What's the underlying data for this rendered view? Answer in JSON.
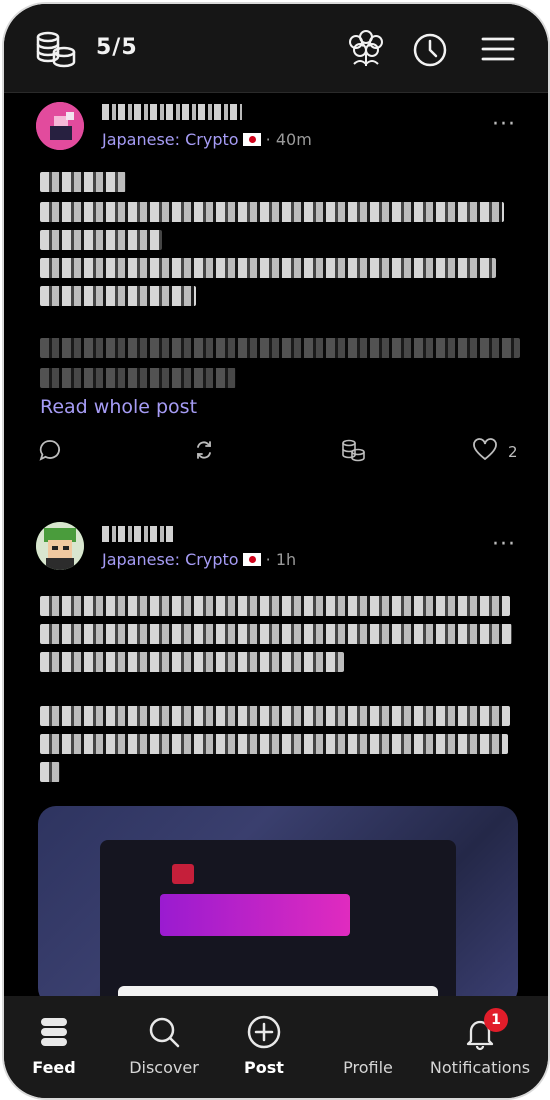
{
  "topbar": {
    "counter": "5/5",
    "icons": [
      "coins-icon",
      "flower-mascot-icon",
      "clock-icon",
      "menu-icon"
    ]
  },
  "posts": [
    {
      "author": "",
      "channel": "Japanese: Crypto",
      "flag": "japan-flag-icon",
      "time": "40m",
      "more": "···",
      "read_more": "Read whole post",
      "likes": "2"
    },
    {
      "author": "",
      "channel": "Japanese: Crypto",
      "flag": "japan-flag-icon",
      "time": "1h",
      "more": "···"
    }
  ],
  "separator": "·",
  "tabs": [
    {
      "label": "Feed",
      "icon": "feed-icon"
    },
    {
      "label": "Discover",
      "icon": "search-icon"
    },
    {
      "label": "Post",
      "icon": "plus-circle-icon"
    },
    {
      "label": "Profile",
      "icon": "profile-icon"
    },
    {
      "label": "Notifications",
      "icon": "bell-icon",
      "badge": "1"
    }
  ],
  "colors": {
    "background": "#000000",
    "bars": "#1a1a1a",
    "accent": "#a69cf5",
    "badge": "#e11d2a"
  }
}
